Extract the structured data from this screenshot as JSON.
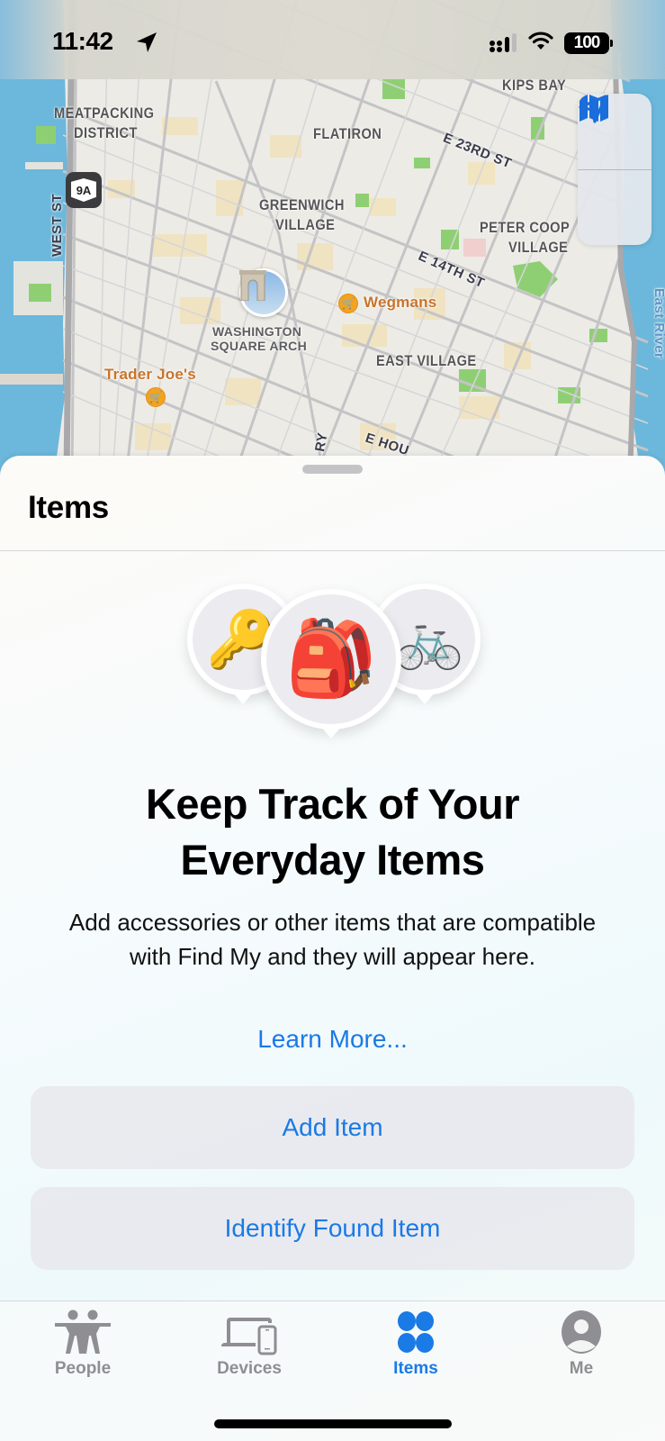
{
  "status_bar": {
    "time": "11:42",
    "location_icon": "location-arrow-icon",
    "signal_icon": "cellular-signal-icon",
    "wifi_icon": "wifi-icon",
    "battery_level": "100"
  },
  "map": {
    "labels": {
      "kips_bay": "KIPS BAY",
      "meatpacking_1": "MEATPACKING",
      "meatpacking_2": "DISTRICT",
      "flatiron": "FLATIRON",
      "e23rd": "E 23RD ST",
      "greenwich_1": "GREENWICH",
      "greenwich_2": "VILLAGE",
      "peter_cooper_1": "PETER COOP",
      "peter_cooper_2": "VILLAGE",
      "route": "9A",
      "west_st": "WEST ST",
      "e14th": "E 14TH ST",
      "east_river": "East River",
      "washington_1": "WASHINGTON",
      "washington_2": "SQUARE ARCH",
      "wegmans": "Wegmans",
      "east_village": "EAST VILLAGE",
      "trader_joes": "Trader Joe's",
      "bowery": "RY",
      "e_houston": "E HOU"
    },
    "controls": {
      "map_mode_icon": "map-icon",
      "locate_icon": "location-arrow-icon"
    },
    "colors": {
      "water": "#6cb7dc",
      "land": "#ecebe6",
      "park": "#8fcf74",
      "road": "#c4c4c6",
      "poi": "#f2a320",
      "control_accent": "#1a6ddb"
    }
  },
  "sheet": {
    "title": "Items",
    "illustration": {
      "left": "🔑",
      "center": "🎒",
      "right": "🚲"
    },
    "headline_line1": "Keep Track of Your",
    "headline_line2": "Everyday Items",
    "body": "Add accessories or other items that are compatible with Find My and they will appear here.",
    "learn_more": "Learn More...",
    "add_item": "Add Item",
    "identify_found_item": "Identify Found Item"
  },
  "tab_bar": {
    "tabs": [
      {
        "label": "People",
        "icon": "people-icon",
        "active": false
      },
      {
        "label": "Devices",
        "icon": "devices-icon",
        "active": false
      },
      {
        "label": "Items",
        "icon": "items-icon",
        "active": true
      },
      {
        "label": "Me",
        "icon": "person-circle-icon",
        "active": false
      }
    ],
    "accent_color": "#1a7ae6",
    "inactive_color": "#8e8e93"
  }
}
